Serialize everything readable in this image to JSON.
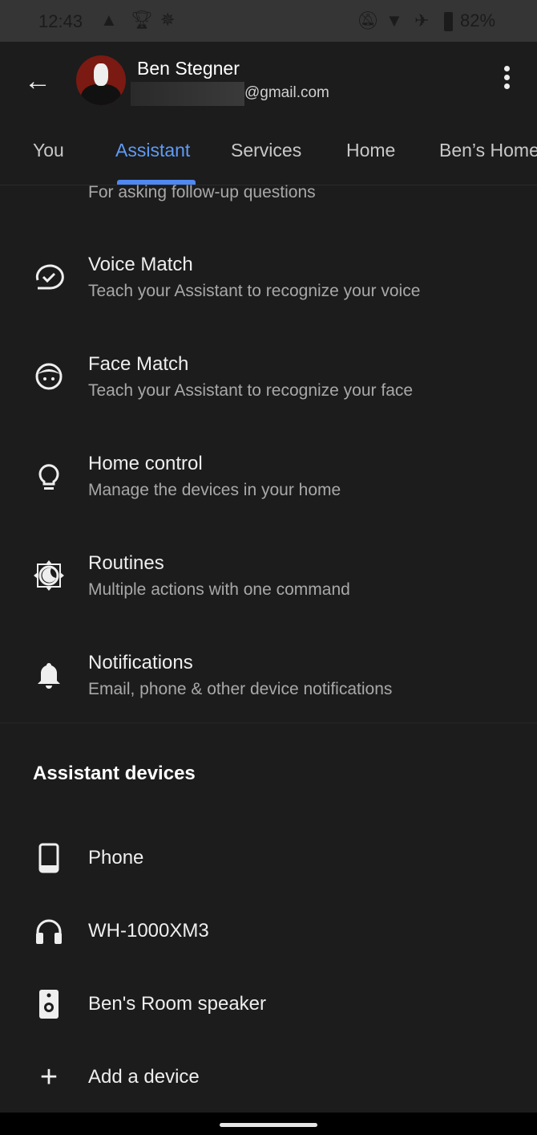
{
  "status_bar": {
    "time": "12:43",
    "battery": "82%",
    "icons": [
      "navigation-icon",
      "trophy-icon",
      "tree-icon",
      "notifications-off-icon",
      "wifi-icon",
      "airplane-icon",
      "battery-icon"
    ]
  },
  "header": {
    "name": "Ben Stegner",
    "email_suffix": "@gmail.com"
  },
  "tabs": [
    {
      "label": "You"
    },
    {
      "label": "Assistant"
    },
    {
      "label": "Services"
    },
    {
      "label": "Home"
    },
    {
      "label": "Ben’s Home"
    }
  ],
  "active_tab": "Assistant",
  "accent_color": "#5f9bf5",
  "partial_item": {
    "subtitle": "For asking follow-up questions"
  },
  "items": [
    {
      "title": "Voice Match",
      "subtitle": "Teach your Assistant to recognize your voice",
      "icon": "voice-match-icon"
    },
    {
      "title": "Face Match",
      "subtitle": "Teach your Assistant to recognize your face",
      "icon": "face-icon"
    },
    {
      "title": "Home control",
      "subtitle": "Manage the devices in your home",
      "icon": "lightbulb-icon"
    },
    {
      "title": "Routines",
      "subtitle": "Multiple actions with one command",
      "icon": "routines-icon"
    },
    {
      "title": "Notifications",
      "subtitle": "Email, phone & other device notifications",
      "icon": "bell-icon"
    }
  ],
  "devices_section": {
    "title": "Assistant devices",
    "items": [
      {
        "label": "Phone",
        "icon": "phone-icon"
      },
      {
        "label": "WH-1000XM3",
        "icon": "headphones-icon"
      },
      {
        "label": "Ben's Room speaker",
        "icon": "speaker-icon"
      },
      {
        "label": "Add a device",
        "icon": "plus-icon"
      }
    ]
  }
}
